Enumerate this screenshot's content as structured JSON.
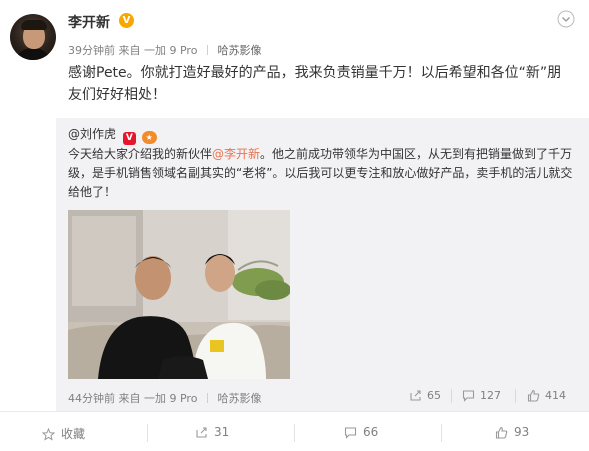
{
  "post": {
    "author": "李开新",
    "verified_badge": "V",
    "time": "39分钟前",
    "source": "来自 一加 9 Pro",
    "location": "哈苏影像",
    "text": "感谢Pete。你就打造好最好的产品，我来负责销量千万！以后希望和各位“新”朋友们好好相处！",
    "menu_icon": "chevron-down-icon"
  },
  "repost": {
    "author": "@刘作虎",
    "badge_text": "V",
    "text_before": "今天给大家介绍我的新伙伴",
    "mention": "@李开新",
    "text_after": "。他之前成功带领华为中国区，从无到有把销量做到了千万级，是手机销售领域名副其实的“老将”。以后我可以更专注和放心做好产品，卖手机的活儿就交给他了！",
    "time": "44分钟前",
    "source": "来自 一加 9 Pro",
    "location": "哈苏影像",
    "actions": {
      "share": "65",
      "comment": "127",
      "like": "414"
    }
  },
  "footer": {
    "favorite": "收藏",
    "share": "31",
    "comment": "66",
    "like": "93"
  },
  "colors": {
    "accent": "#eb7350",
    "verified": "#f7a800",
    "muted": "#808080"
  }
}
